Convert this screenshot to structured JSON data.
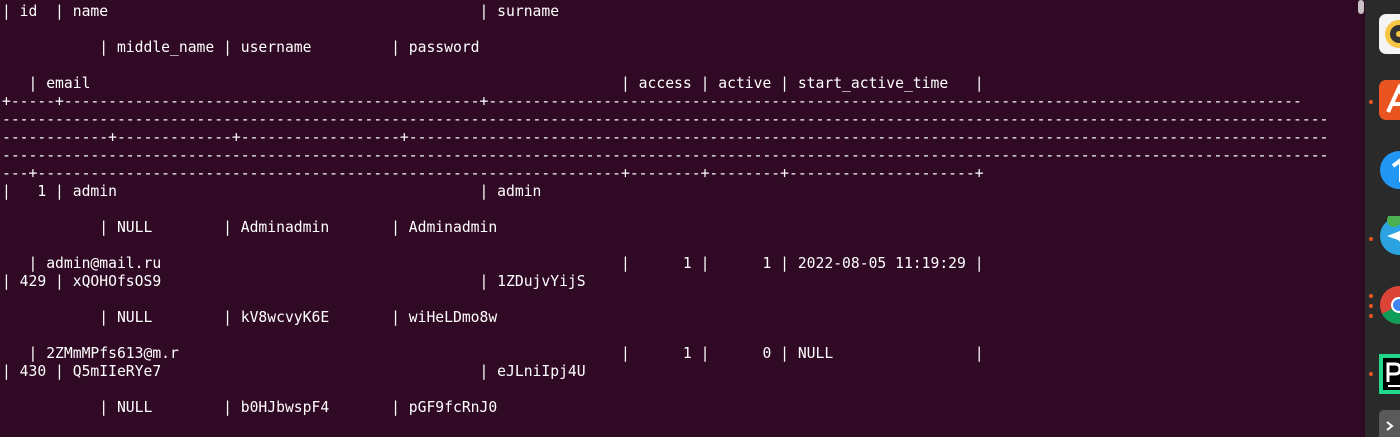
{
  "terminal": {
    "lines": [
      "| id  | name                                          | surname",
      "",
      "           | middle_name | username         | password",
      "",
      "   | email                                                            | access | active | start_active_time   |",
      "+-----+-----------------------------------------------+--------------------------------------------------------------------------------------------",
      "------------------------------------------------------------------------------------------------------------------------------------------------------",
      "------------+-------------+------------------+--------------------------------------------------------------------------------------------------------",
      "------------------------------------------------------------------------------------------------------------------------------------------------------",
      "---+------------------------------------------------------------------+--------+--------+---------------------+",
      "|   1 | admin                                         | admin",
      "",
      "           | NULL        | Adminadmin       | Adminadmin",
      "",
      "   | admin@mail.ru                                                    |      1 |      1 | 2022-08-05 11:19:29 |",
      "| 429 | xQOHOfsOS9                                    | 1ZDujvYijS",
      "",
      "           | NULL        | kV8wcvyK6E       | wiHeLDmo8w",
      "",
      "   | 2ZMmMPfs613@m.r                                                  |      1 |      0 | NULL                |",
      "| 430 | Q5mIIeRYe7                                    | eJLniIpj4U",
      "",
      "           | NULL        | b0HJbwspF4       | pGF9fcRnJ0",
      ""
    ]
  },
  "dock": {
    "icons": [
      {
        "name": "rhythmbox-icon",
        "color": "#f6c644"
      },
      {
        "name": "app-center-icon",
        "color": "#e95420"
      },
      {
        "name": "blue-app-icon",
        "color": "#2196f3"
      },
      {
        "name": "telegram-icon",
        "color": "#2aa3e0"
      },
      {
        "name": "chrome-icon",
        "color": "#db4437"
      },
      {
        "name": "pycharm-icon",
        "color": "#21d789"
      },
      {
        "name": "terminal-icon",
        "color": "#5a5a5a"
      }
    ]
  }
}
